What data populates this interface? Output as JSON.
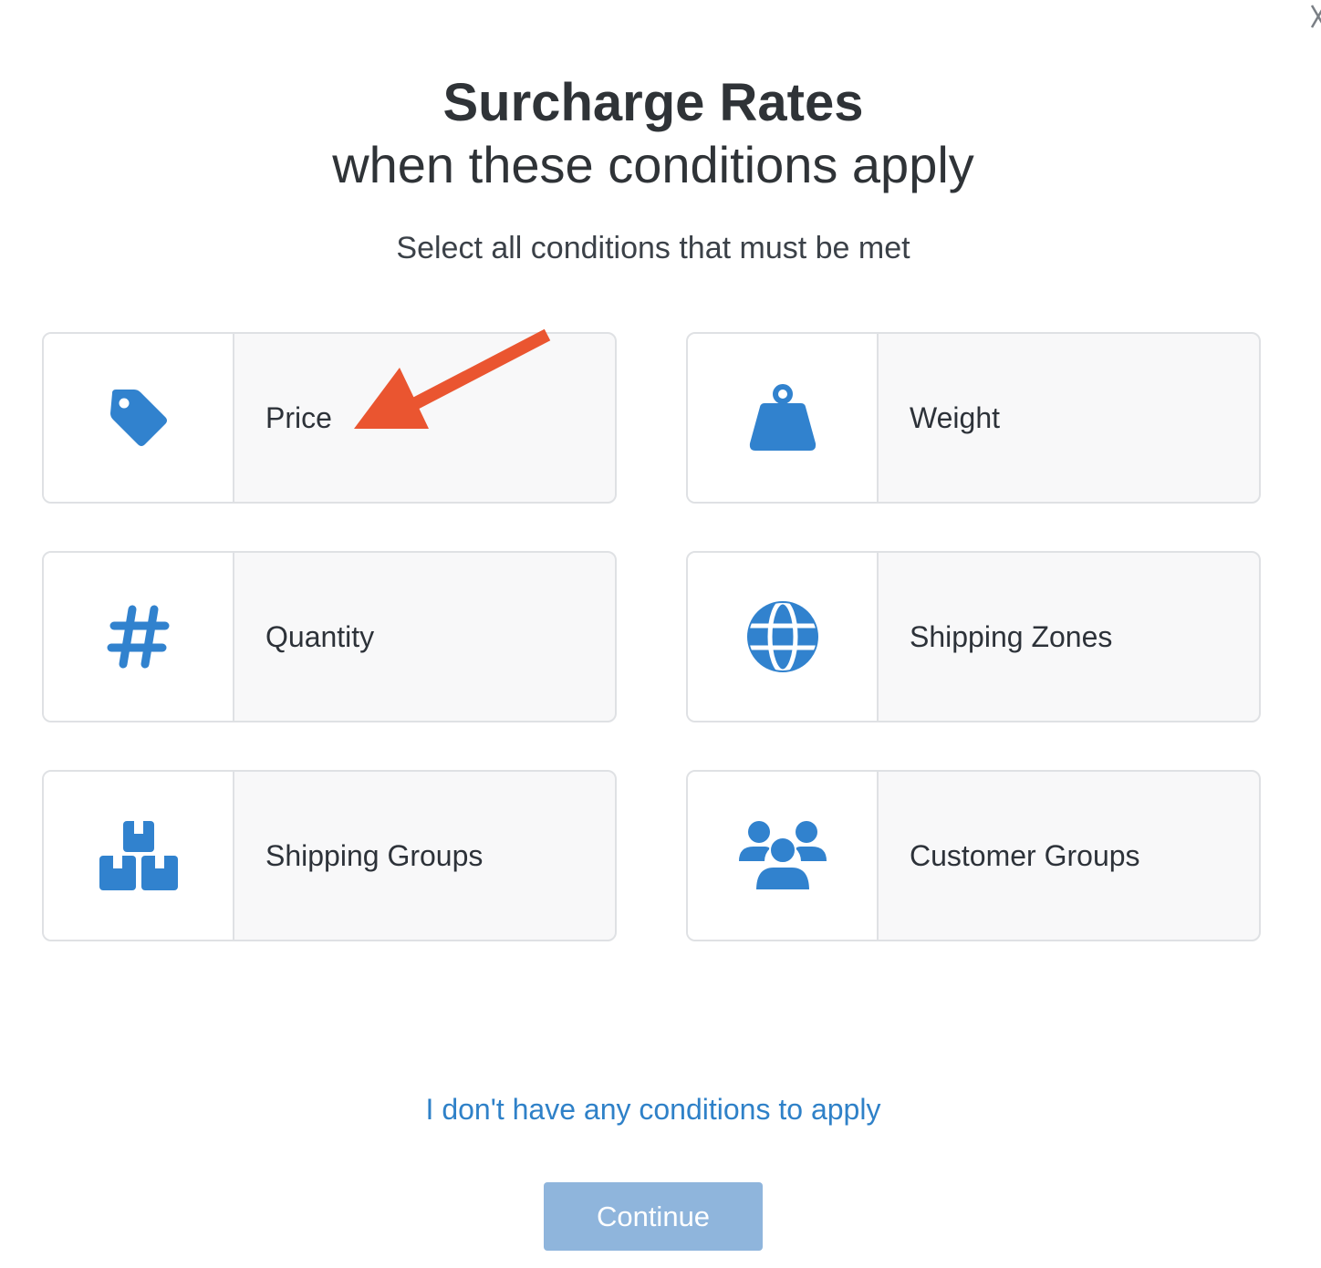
{
  "dialog": {
    "title": "Surcharge Rates",
    "title_line2": "when these conditions apply",
    "subtitle": "Select all conditions that must be met",
    "close_icon": "close-icon"
  },
  "conditions": [
    {
      "label": "Price",
      "icon": "price-tag-icon"
    },
    {
      "label": "Weight",
      "icon": "weight-icon"
    },
    {
      "label": "Quantity",
      "icon": "hashtag-icon"
    },
    {
      "label": "Shipping Zones",
      "icon": "globe-icon"
    },
    {
      "label": "Shipping Groups",
      "icon": "boxes-icon"
    },
    {
      "label": "Customer Groups",
      "icon": "users-icon"
    }
  ],
  "no_conditions_link": "I don't have any conditions to apply",
  "continue_label": "Continue",
  "colors": {
    "accent": "#2f81c8",
    "icon": "#3182ce",
    "continue_disabled": "#8fb5dc",
    "annotation_arrow": "#ea5530"
  }
}
